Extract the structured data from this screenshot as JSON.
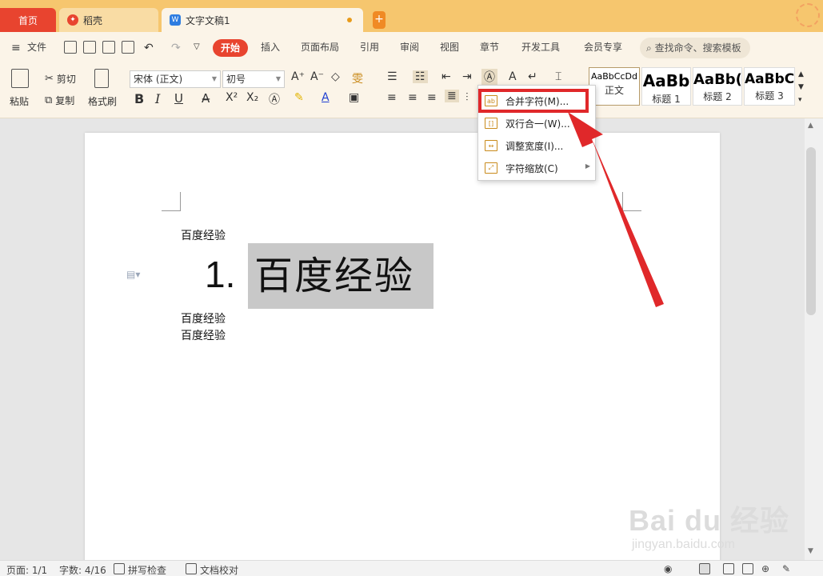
{
  "tabs": {
    "home": "首页",
    "daoke": "稻壳",
    "doc": "文字文稿1",
    "new_tab": "+"
  },
  "menu": {
    "file": "文件",
    "active": "开始",
    "items": [
      "插入",
      "页面布局",
      "引用",
      "审阅",
      "视图",
      "章节",
      "开发工具",
      "会员专享"
    ],
    "search": "查找命令、搜索模板"
  },
  "ribbon": {
    "paste": "粘贴",
    "cut": "剪切",
    "copy": "复制",
    "format_painter": "格式刷",
    "font_name": "宋体 (正文)",
    "font_size": "初号",
    "bold": "B",
    "italic": "I",
    "underline": "U",
    "superscript": "X²",
    "subscript": "X₂",
    "font_color": "A",
    "grow_font": "A⁺",
    "shrink_font": "A⁻",
    "phonetic": "雯"
  },
  "styles": [
    {
      "sample": "AaBbCcDd",
      "name": "正文"
    },
    {
      "sample": "AaBb",
      "name": "标题 1"
    },
    {
      "sample": "AaBb(",
      "name": "标题 2"
    },
    {
      "sample": "AaBbC(",
      "name": "标题 3"
    }
  ],
  "dropdown": {
    "items": [
      {
        "label": "合并字符(M)...",
        "icon": "combine-chars-icon"
      },
      {
        "label": "双行合一(W)...",
        "icon": "two-lines-in-one-icon"
      },
      {
        "label": "调整宽度(I)...",
        "icon": "adjust-width-icon"
      },
      {
        "label": "字符缩放(C)",
        "icon": "char-scale-icon"
      }
    ]
  },
  "document": {
    "para1": "百度经验",
    "list_number": "1.",
    "list_text": "百度经验",
    "para2": "百度经验",
    "para3": "百度经验"
  },
  "status": {
    "page": "页面: 1/1",
    "words": "字数: 4/16",
    "spell": "拼写检查",
    "proof": "文档校对"
  },
  "watermark": {
    "main": "Bai du 经验",
    "sub": "jingyan.baidu.com"
  },
  "colors": {
    "accent": "#e8442f",
    "tabbar": "#f6c66e",
    "ribbon": "#fbf4e8",
    "highlight": "#e0282a"
  }
}
